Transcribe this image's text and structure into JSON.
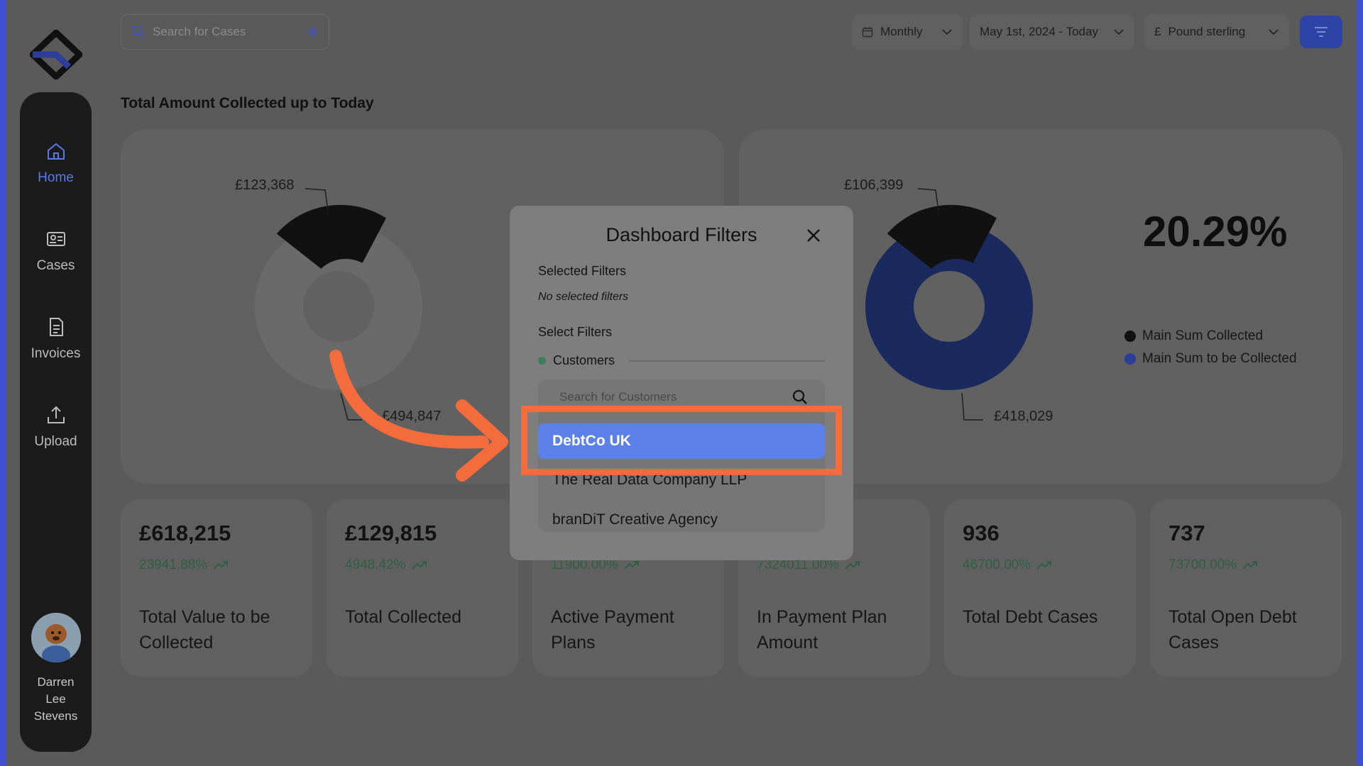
{
  "colors": {
    "accent": "#5b80e8",
    "highlight": "#f46b3c",
    "positive": "#2f5e43",
    "collected": "#111111",
    "to_be_collected": "#1a2a5e"
  },
  "sidebar": {
    "items": [
      {
        "label": "Home",
        "icon": "home-icon",
        "active": true
      },
      {
        "label": "Cases",
        "icon": "id-card-icon",
        "active": false
      },
      {
        "label": "Invoices",
        "icon": "document-icon",
        "active": false
      },
      {
        "label": "Upload",
        "icon": "upload-icon",
        "active": false
      }
    ],
    "user": {
      "name": "Darren Lee Stevens"
    }
  },
  "topbar": {
    "search_placeholder": "Search for Cases",
    "period": "Monthly",
    "date_range": "May 1st, 2024 - Today",
    "currency_symbol": "£",
    "currency": "Pound sterling"
  },
  "main": {
    "section_title": "Total Amount Collected up to Today",
    "left_chart": {
      "top_label": "£123,368",
      "bottom_label": "£494,847"
    },
    "right_chart": {
      "top_label": "£106,399",
      "bottom_label": "£418,029",
      "percentage": "20.29%"
    },
    "legend": [
      {
        "label": "Main Sum Collected",
        "color": "#111111"
      },
      {
        "label": "Main Sum to be Collected",
        "color": "#1a2a5e"
      }
    ],
    "stats": [
      {
        "value": "£618,215",
        "change": "23941.88%",
        "label": "Total Value to be Collected"
      },
      {
        "value": "£129,815",
        "change": "4948.42%",
        "label": "Total Collected"
      },
      {
        "value": "",
        "change": "11900.00%",
        "label": "Active Payment Plans"
      },
      {
        "value": "",
        "change": "7324011.00%",
        "label": "In Payment Plan Amount"
      },
      {
        "value": "936",
        "change": "46700.00%",
        "label": "Total Debt Cases"
      },
      {
        "value": "737",
        "change": "73700.00%",
        "label": "Total Open Debt Cases"
      }
    ]
  },
  "modal": {
    "title": "Dashboard Filters",
    "selected_heading": "Selected Filters",
    "selected_empty": "No selected filters",
    "select_heading": "Select Filters",
    "filter_tab": "Customers",
    "customer_search_placeholder": "Search for Customers",
    "customers": [
      "DebtCo UK",
      "The Real Data Company LLP",
      "branDiT Creative Agency"
    ]
  }
}
